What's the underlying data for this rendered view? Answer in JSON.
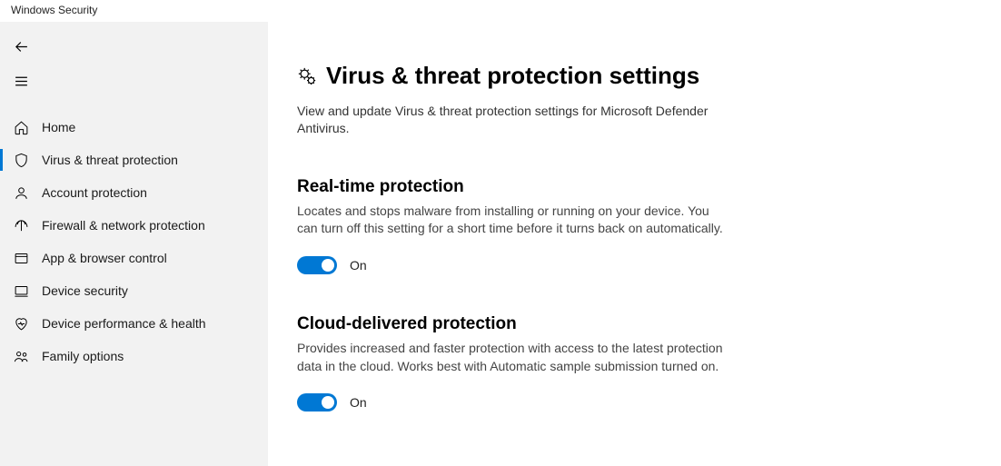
{
  "app_title": "Windows Security",
  "sidebar": {
    "items": [
      {
        "label": "Home"
      },
      {
        "label": "Virus & threat protection"
      },
      {
        "label": "Account protection"
      },
      {
        "label": "Firewall & network protection"
      },
      {
        "label": "App & browser control"
      },
      {
        "label": "Device security"
      },
      {
        "label": "Device performance & health"
      },
      {
        "label": "Family options"
      }
    ]
  },
  "page": {
    "title": "Virus & threat protection settings",
    "subtitle": "View and update Virus & threat protection settings for Microsoft Defender Antivirus."
  },
  "sections": {
    "realtime": {
      "title": "Real-time protection",
      "desc": "Locates and stops malware from installing or running on your device. You can turn off this setting for a short time before it turns back on automatically.",
      "state": "On"
    },
    "cloud": {
      "title": "Cloud-delivered protection",
      "desc": "Provides increased and faster protection with access to the latest protection data in the cloud. Works best with Automatic sample submission turned on.",
      "state": "On"
    }
  }
}
